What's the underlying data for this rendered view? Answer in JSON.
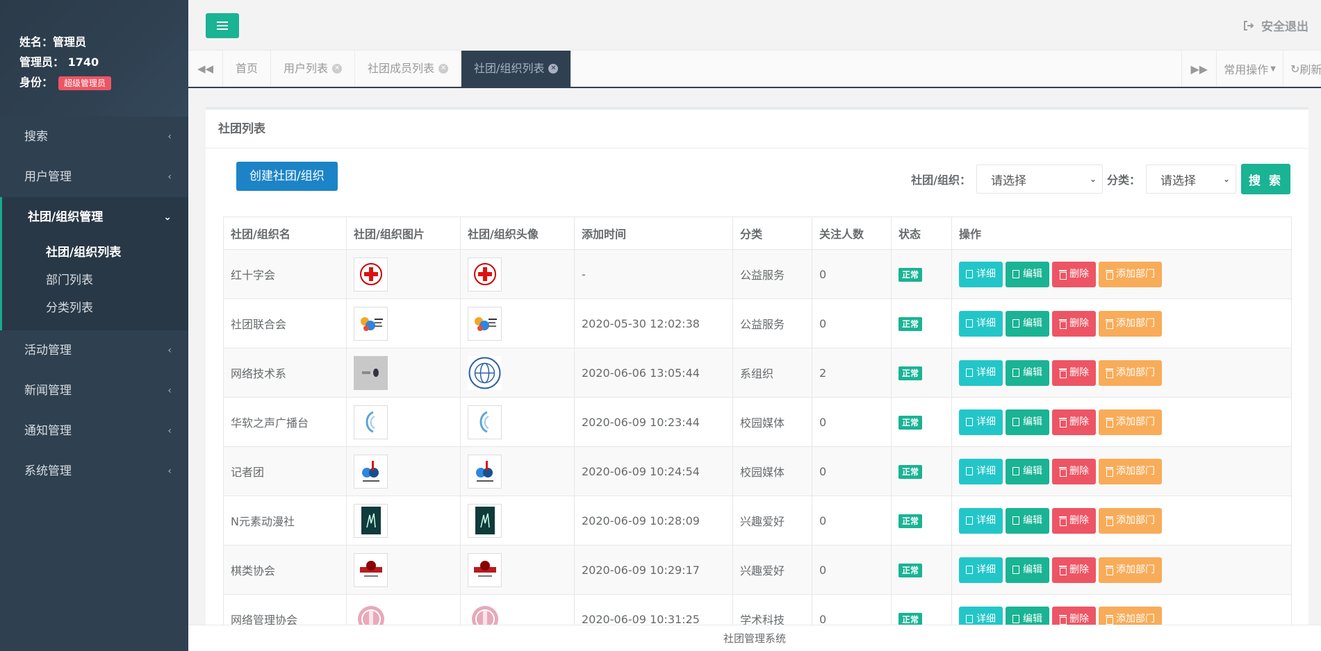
{
  "profile": {
    "name_label": "姓名：管理员",
    "admin_label": "管理员：",
    "admin_id": "1740",
    "role_label": "身份：",
    "role_badge": "超级管理员"
  },
  "sidebar": {
    "items": [
      {
        "label": "搜索"
      },
      {
        "label": "用户管理"
      },
      {
        "label": "社团/组织管理"
      },
      {
        "label": "活动管理"
      },
      {
        "label": "新闻管理"
      },
      {
        "label": "通知管理"
      },
      {
        "label": "系统管理"
      }
    ],
    "sub_items": [
      {
        "label": "社团/组织列表"
      },
      {
        "label": "部门列表"
      },
      {
        "label": "分类列表"
      }
    ]
  },
  "topbar": {
    "logout_label": "安全退出"
  },
  "tabs": {
    "items": [
      {
        "label": "首页"
      },
      {
        "label": "用户列表"
      },
      {
        "label": "社团成员列表"
      },
      {
        "label": "社团/组织列表"
      }
    ],
    "common_ops": "常用操作",
    "refresh": "刷新"
  },
  "panel": {
    "title": "社团列表",
    "create_button": "创建社团/组织",
    "filter_org_label": "社团/组织：",
    "filter_org_value": "请选择",
    "filter_cat_label": "分类：",
    "filter_cat_value": "请选择",
    "search_button": "搜 索"
  },
  "table": {
    "headers": [
      "社团/组织名",
      "社团/组织图片",
      "社团/组织头像",
      "添加时间",
      "分类",
      "关注人数",
      "状态",
      "操作"
    ],
    "actions": {
      "detail": "详细",
      "edit": "编辑",
      "delete": "删除",
      "add_dept": "添加部门"
    },
    "rows": [
      {
        "name": "红十字会",
        "time": "-",
        "category": "公益服务",
        "followers": "0",
        "status": "正常",
        "img": "red-cross"
      },
      {
        "name": "社团联合会",
        "time": "2020-05-30 12:02:38",
        "category": "公益服务",
        "followers": "0",
        "status": "正常",
        "img": "club-union"
      },
      {
        "name": "网络技术系",
        "time": "2020-06-06 13:05:44",
        "category": "系组织",
        "followers": "2",
        "status": "正常",
        "img": "network-dept"
      },
      {
        "name": "华软之声广播台",
        "time": "2020-06-09 10:23:44",
        "category": "校园媒体",
        "followers": "0",
        "status": "正常",
        "img": "radio"
      },
      {
        "name": "记者团",
        "time": "2020-06-09 10:24:54",
        "category": "校园媒体",
        "followers": "0",
        "status": "正常",
        "img": "reporters"
      },
      {
        "name": "N元素动漫社",
        "time": "2020-06-09 10:28:09",
        "category": "兴趣爱好",
        "followers": "0",
        "status": "正常",
        "img": "anime"
      },
      {
        "name": "棋类协会",
        "time": "2020-06-09 10:29:17",
        "category": "兴趣爱好",
        "followers": "0",
        "status": "正常",
        "img": "chess"
      },
      {
        "name": "网络管理协会",
        "time": "2020-06-09 10:31:25",
        "category": "学术科技",
        "followers": "0",
        "status": "正常",
        "img": "netmgmt"
      }
    ]
  },
  "footer": {
    "text": "社团管理系统"
  },
  "colors": {
    "sidebar_bg": "#2f4050",
    "primary": "#1ab394",
    "info": "#23c6c8",
    "danger": "#ed5565",
    "warning": "#f8ac59",
    "blue": "#1c84c6"
  }
}
